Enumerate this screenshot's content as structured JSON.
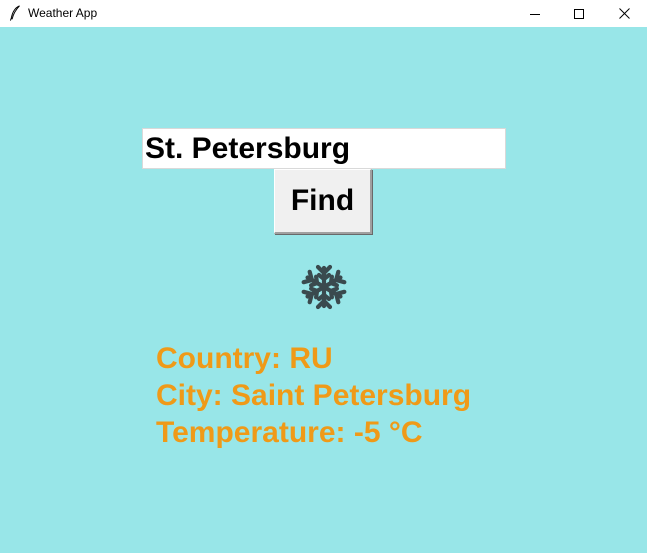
{
  "window": {
    "title": "Weather App",
    "icon": "feather-icon",
    "controls": [
      "minimize-icon",
      "maximize-icon",
      "close-icon"
    ]
  },
  "search": {
    "value": "St. Petersburg"
  },
  "find_button": {
    "label": "Find"
  },
  "weather": {
    "icon": "snowflake-icon",
    "icon_color": "#3a4a4e"
  },
  "results": {
    "country": "Country: RU",
    "city": "City: Saint Petersburg",
    "temperature": "Temperature: -5 °C"
  },
  "colors": {
    "background": "#98e6e8",
    "result_text": "#ef9a18"
  }
}
